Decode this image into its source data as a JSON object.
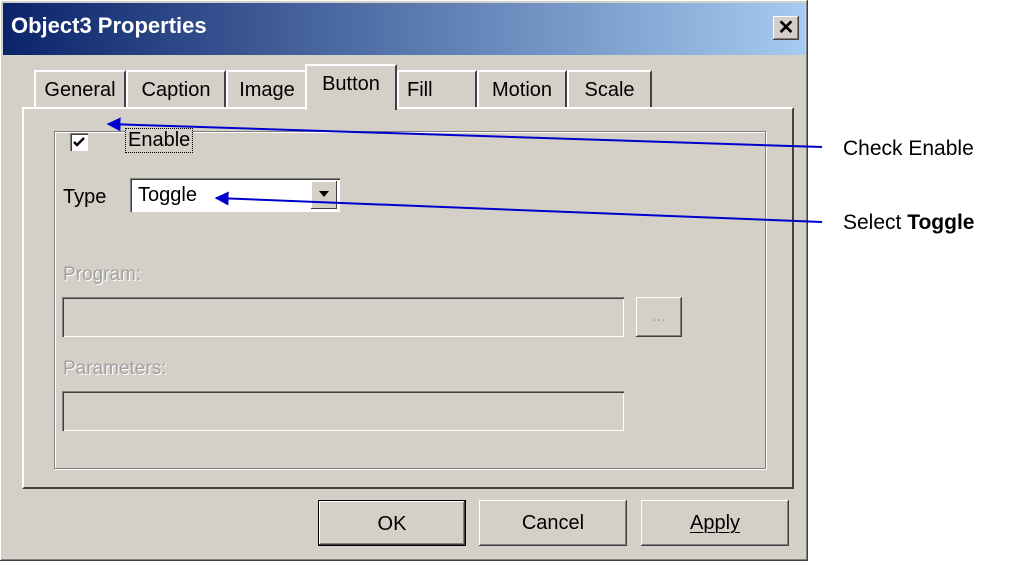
{
  "window": {
    "title": "Object3 Properties",
    "close_label": "✕"
  },
  "tabs": [
    {
      "label": "General"
    },
    {
      "label": "Caption"
    },
    {
      "label": "Image"
    },
    {
      "label": "Button",
      "active": true
    },
    {
      "label": "Fill"
    },
    {
      "label": "Motion"
    },
    {
      "label": "Scale"
    }
  ],
  "button_tab": {
    "enable_label": "Enable",
    "enable_checked": true,
    "type_label": "Type",
    "type_value": "Toggle",
    "program_label": "Program:",
    "program_value": "",
    "browse_label": "...",
    "parameters_label": "Parameters:",
    "parameters_value": ""
  },
  "footer": {
    "ok_label": "OK",
    "cancel_label": "Cancel",
    "apply_label": "Apply"
  },
  "annotations": {
    "check_enable": "Check Enable",
    "select_prefix": "Select ",
    "select_bold": "Toggle"
  },
  "colors": {
    "titlebar_start": "#0a246a",
    "titlebar_end": "#a6caf0",
    "face": "#d4d0c8",
    "arrow": "#0000cc"
  }
}
